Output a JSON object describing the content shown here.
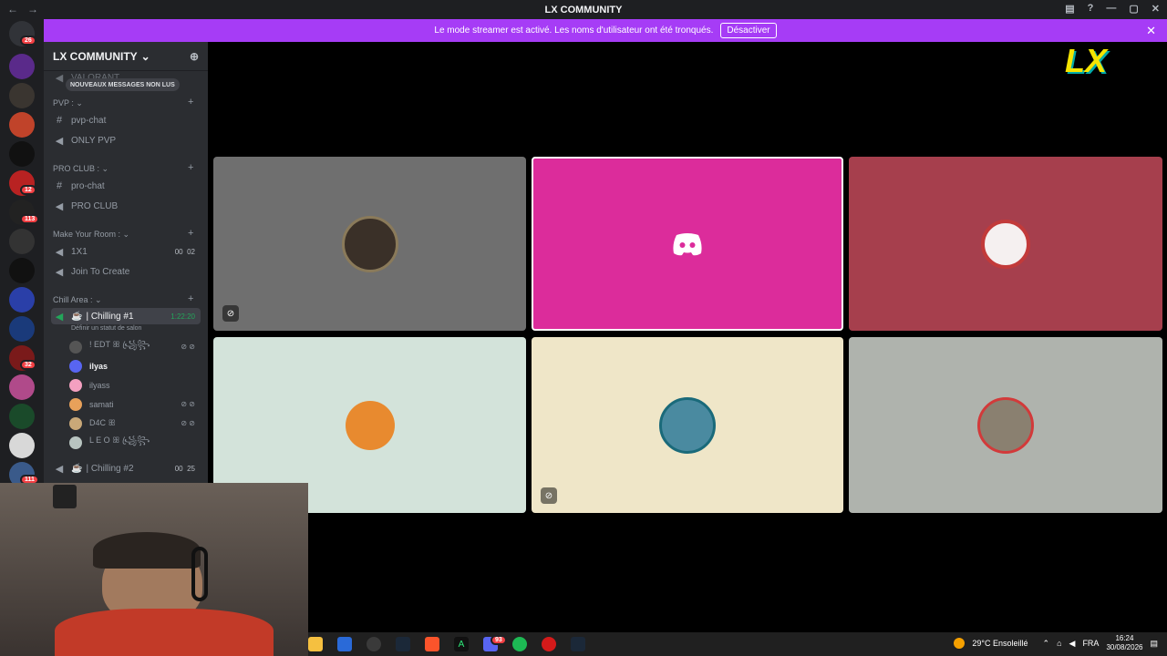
{
  "window": {
    "title": "LX COMMUNITY"
  },
  "banner": {
    "text": "Le mode streamer est activé. Les noms d'utilisateur ont été tronqués.",
    "button": "Désactiver"
  },
  "guilds": {
    "badges": [
      "26",
      "12",
      "113",
      "32",
      "111"
    ]
  },
  "server": {
    "name": "LX COMMUNITY",
    "new_messages": "NOUVEAUX MESSAGES NON LUS",
    "top_channel": "VALORANT"
  },
  "categories": [
    {
      "name": "PVP :",
      "channels": [
        {
          "name": "pvp-chat",
          "type": "text"
        },
        {
          "name": "ONLY PVP",
          "type": "voice"
        }
      ]
    },
    {
      "name": "PRO CLUB :",
      "channels": [
        {
          "name": "pro-chat",
          "type": "text"
        },
        {
          "name": "PRO CLUB",
          "type": "voice"
        }
      ]
    },
    {
      "name": "Make Your Room :",
      "channels": [
        {
          "name": "1X1",
          "type": "voice",
          "count": "00",
          "limit": "02"
        },
        {
          "name": "Join To Create",
          "type": "voice"
        }
      ]
    },
    {
      "name": "Chill Area :",
      "channels": [
        {
          "name": "| Chilling #1",
          "type": "voice",
          "time": "1:22:20"
        },
        {
          "name": "| Chilling #2",
          "type": "voice",
          "count": "00",
          "limit": "25"
        }
      ]
    }
  ],
  "status_text": "Définir un statut de salon",
  "members": [
    {
      "name": "! EDT ꕥ ꧁ꦿ꧂",
      "color": "#555",
      "muted": true
    },
    {
      "name": "ilyas",
      "color": "#5865f2",
      "muted": false
    },
    {
      "name": "ilyass",
      "color": "#f4a0c0",
      "muted": false
    },
    {
      "name": "samati",
      "color": "#e8a15a",
      "muted": true
    },
    {
      "name": "D4C ꕥ",
      "color": "#c9a878",
      "muted": true
    },
    {
      "name": "L E O ꕥ ꧁ꦿ꧂",
      "color": "#b8c4c0",
      "muted": false
    }
  ],
  "logo_text": "LX",
  "tiles": [
    {
      "bg": "#6f6f6f",
      "avatar": "#3a3028",
      "muted": true,
      "active": false
    },
    {
      "bg": "#dc2c9b",
      "avatar": "discord",
      "muted": false,
      "active": true
    },
    {
      "bg": "#a63f4d",
      "avatar": "#c23a3a",
      "muted": false,
      "active": false
    },
    {
      "bg": "#d3e3da",
      "avatar": "#e88a2f",
      "muted": false,
      "active": false
    },
    {
      "bg": "#efe6c8",
      "avatar": "#4a8aa0",
      "muted": true,
      "active": false
    },
    {
      "bg": "#afb3ad",
      "avatar": "#8a8070",
      "muted": false,
      "active": false
    }
  ],
  "tray": {
    "weather": "29°C Ensoleillé",
    "lang": "FRA",
    "time": "16:24",
    "date": "30/08/2026",
    "discord_badge": "93"
  },
  "colors": {
    "accent": "#a63cf6",
    "online": "#23a55a",
    "danger": "#f23f43"
  }
}
